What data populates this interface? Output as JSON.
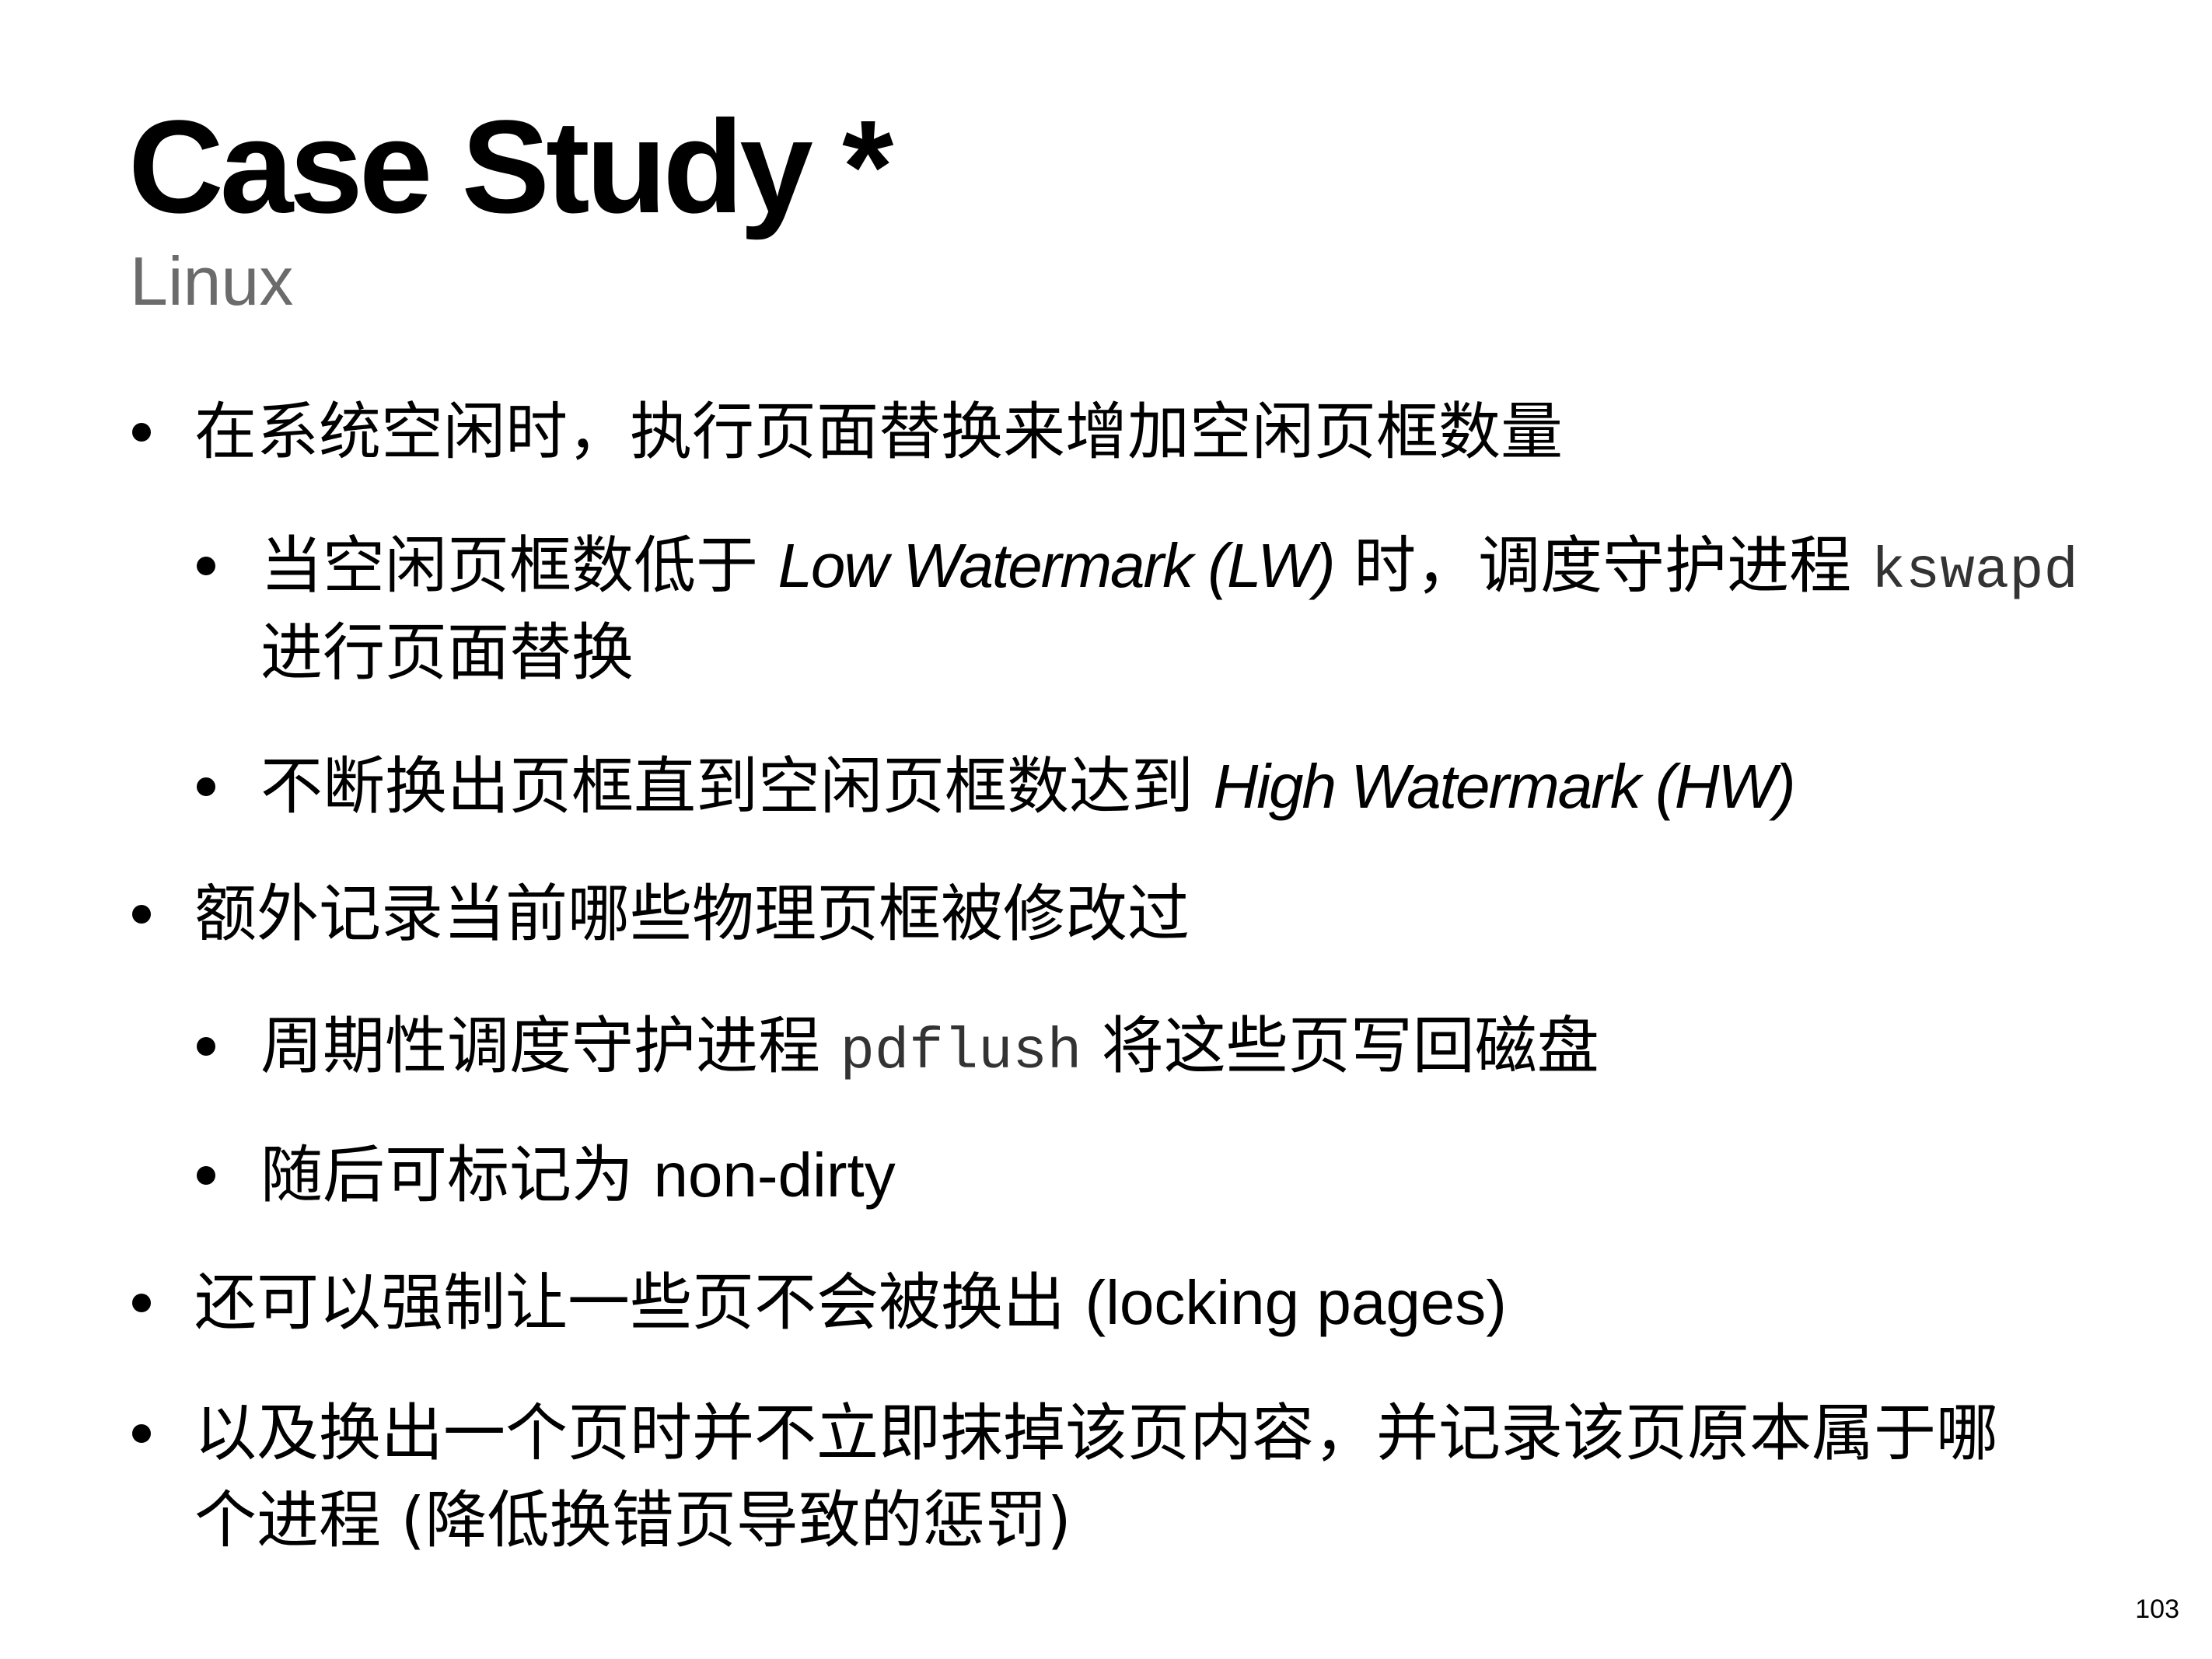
{
  "slide": {
    "title": "Case Study *",
    "subtitle": "Linux",
    "page_number": "103"
  },
  "bullets": [
    {
      "level": 1,
      "text": "在系统空闲时，执行页面替换来增加空闲页框数量"
    },
    {
      "level": 2,
      "text_a": "当空闲页框数低于 ",
      "term": "Low Watermark (LW)",
      "text_b": " 时，调度守护进程 ",
      "code": "kswapd",
      "line2": "进行页面替换"
    },
    {
      "level": 2,
      "text_a": "不断换出页框直到空闲页框数达到 ",
      "term": "High Watermark (HW)"
    },
    {
      "level": 1,
      "text": "额外记录当前哪些物理页框被修改过"
    },
    {
      "level": 2,
      "text_a": "周期性调度守护进程 ",
      "code": "pdflush",
      "text_b": " 将这些页写回磁盘"
    },
    {
      "level": 2,
      "text_a": "随后可标记为 ",
      "term": "non-dirty"
    },
    {
      "level": 1,
      "text_a": "还可以强制让一些页不会被换出 ",
      "term": "(locking pages)"
    },
    {
      "level": 1,
      "line1": "以及换出一个页时并不立即抹掉该页内容，并记录该页原本属于哪",
      "line2_a": "个进程 ",
      "line2_b": "(降低换错页导致的惩罚)"
    }
  ]
}
